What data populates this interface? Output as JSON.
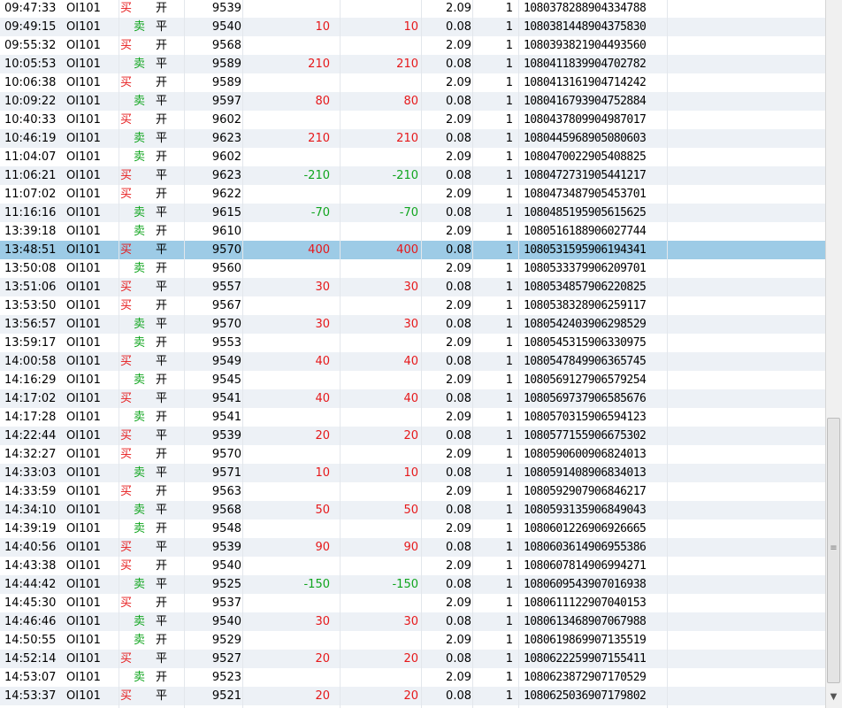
{
  "trades": [
    {
      "time": "09:47:33",
      "code": "OI101",
      "dir": "买",
      "oc": "开",
      "price": "9539",
      "pnl": "",
      "pnl2": "",
      "fee": "2.09",
      "qty": "1",
      "id": "1080378288904334788"
    },
    {
      "time": "09:49:15",
      "code": "OI101",
      "dir": "卖",
      "oc": "平",
      "price": "9540",
      "pnl": "10",
      "pnl2": "10",
      "fee": "0.08",
      "qty": "1",
      "id": "1080381448904375830"
    },
    {
      "time": "09:55:32",
      "code": "OI101",
      "dir": "买",
      "oc": "开",
      "price": "9568",
      "pnl": "",
      "pnl2": "",
      "fee": "2.09",
      "qty": "1",
      "id": "1080393821904493560"
    },
    {
      "time": "10:05:53",
      "code": "OI101",
      "dir": "卖",
      "oc": "平",
      "price": "9589",
      "pnl": "210",
      "pnl2": "210",
      "fee": "0.08",
      "qty": "1",
      "id": "1080411839904702782"
    },
    {
      "time": "10:06:38",
      "code": "OI101",
      "dir": "买",
      "oc": "开",
      "price": "9589",
      "pnl": "",
      "pnl2": "",
      "fee": "2.09",
      "qty": "1",
      "id": "1080413161904714242"
    },
    {
      "time": "10:09:22",
      "code": "OI101",
      "dir": "卖",
      "oc": "平",
      "price": "9597",
      "pnl": "80",
      "pnl2": "80",
      "fee": "0.08",
      "qty": "1",
      "id": "1080416793904752884"
    },
    {
      "time": "10:40:33",
      "code": "OI101",
      "dir": "买",
      "oc": "开",
      "price": "9602",
      "pnl": "",
      "pnl2": "",
      "fee": "2.09",
      "qty": "1",
      "id": "1080437809904987017"
    },
    {
      "time": "10:46:19",
      "code": "OI101",
      "dir": "卖",
      "oc": "平",
      "price": "9623",
      "pnl": "210",
      "pnl2": "210",
      "fee": "0.08",
      "qty": "1",
      "id": "1080445968905080603"
    },
    {
      "time": "11:04:07",
      "code": "OI101",
      "dir": "卖",
      "oc": "开",
      "price": "9602",
      "pnl": "",
      "pnl2": "",
      "fee": "2.09",
      "qty": "1",
      "id": "1080470022905408825"
    },
    {
      "time": "11:06:21",
      "code": "OI101",
      "dir": "买",
      "oc": "平",
      "price": "9623",
      "pnl": "-210",
      "pnl2": "-210",
      "fee": "0.08",
      "qty": "1",
      "id": "1080472731905441217"
    },
    {
      "time": "11:07:02",
      "code": "OI101",
      "dir": "买",
      "oc": "开",
      "price": "9622",
      "pnl": "",
      "pnl2": "",
      "fee": "2.09",
      "qty": "1",
      "id": "1080473487905453701"
    },
    {
      "time": "11:16:16",
      "code": "OI101",
      "dir": "卖",
      "oc": "平",
      "price": "9615",
      "pnl": "-70",
      "pnl2": "-70",
      "fee": "0.08",
      "qty": "1",
      "id": "1080485195905615625"
    },
    {
      "time": "13:39:18",
      "code": "OI101",
      "dir": "卖",
      "oc": "开",
      "price": "9610",
      "pnl": "",
      "pnl2": "",
      "fee": "2.09",
      "qty": "1",
      "id": "1080516188906027744"
    },
    {
      "time": "13:48:51",
      "code": "OI101",
      "dir": "买",
      "oc": "平",
      "price": "9570",
      "pnl": "400",
      "pnl2": "400",
      "fee": "0.08",
      "qty": "1",
      "id": "1080531595906194341",
      "selected": true
    },
    {
      "time": "13:50:08",
      "code": "OI101",
      "dir": "卖",
      "oc": "开",
      "price": "9560",
      "pnl": "",
      "pnl2": "",
      "fee": "2.09",
      "qty": "1",
      "id": "1080533379906209701"
    },
    {
      "time": "13:51:06",
      "code": "OI101",
      "dir": "买",
      "oc": "平",
      "price": "9557",
      "pnl": "30",
      "pnl2": "30",
      "fee": "0.08",
      "qty": "1",
      "id": "1080534857906220825"
    },
    {
      "time": "13:53:50",
      "code": "OI101",
      "dir": "买",
      "oc": "开",
      "price": "9567",
      "pnl": "",
      "pnl2": "",
      "fee": "2.09",
      "qty": "1",
      "id": "1080538328906259117"
    },
    {
      "time": "13:56:57",
      "code": "OI101",
      "dir": "卖",
      "oc": "平",
      "price": "9570",
      "pnl": "30",
      "pnl2": "30",
      "fee": "0.08",
      "qty": "1",
      "id": "1080542403906298529"
    },
    {
      "time": "13:59:17",
      "code": "OI101",
      "dir": "卖",
      "oc": "开",
      "price": "9553",
      "pnl": "",
      "pnl2": "",
      "fee": "2.09",
      "qty": "1",
      "id": "1080545315906330975"
    },
    {
      "time": "14:00:58",
      "code": "OI101",
      "dir": "买",
      "oc": "平",
      "price": "9549",
      "pnl": "40",
      "pnl2": "40",
      "fee": "0.08",
      "qty": "1",
      "id": "1080547849906365745"
    },
    {
      "time": "14:16:29",
      "code": "OI101",
      "dir": "卖",
      "oc": "开",
      "price": "9545",
      "pnl": "",
      "pnl2": "",
      "fee": "2.09",
      "qty": "1",
      "id": "1080569127906579254"
    },
    {
      "time": "14:17:02",
      "code": "OI101",
      "dir": "买",
      "oc": "平",
      "price": "9541",
      "pnl": "40",
      "pnl2": "40",
      "fee": "0.08",
      "qty": "1",
      "id": "1080569737906585676"
    },
    {
      "time": "14:17:28",
      "code": "OI101",
      "dir": "卖",
      "oc": "开",
      "price": "9541",
      "pnl": "",
      "pnl2": "",
      "fee": "2.09",
      "qty": "1",
      "id": "1080570315906594123"
    },
    {
      "time": "14:22:44",
      "code": "OI101",
      "dir": "买",
      "oc": "平",
      "price": "9539",
      "pnl": "20",
      "pnl2": "20",
      "fee": "0.08",
      "qty": "1",
      "id": "1080577155906675302"
    },
    {
      "time": "14:32:27",
      "code": "OI101",
      "dir": "买",
      "oc": "开",
      "price": "9570",
      "pnl": "",
      "pnl2": "",
      "fee": "2.09",
      "qty": "1",
      "id": "1080590600906824013"
    },
    {
      "time": "14:33:03",
      "code": "OI101",
      "dir": "卖",
      "oc": "平",
      "price": "9571",
      "pnl": "10",
      "pnl2": "10",
      "fee": "0.08",
      "qty": "1",
      "id": "1080591408906834013"
    },
    {
      "time": "14:33:59",
      "code": "OI101",
      "dir": "买",
      "oc": "开",
      "price": "9563",
      "pnl": "",
      "pnl2": "",
      "fee": "2.09",
      "qty": "1",
      "id": "1080592907906846217"
    },
    {
      "time": "14:34:10",
      "code": "OI101",
      "dir": "卖",
      "oc": "平",
      "price": "9568",
      "pnl": "50",
      "pnl2": "50",
      "fee": "0.08",
      "qty": "1",
      "id": "1080593135906849043"
    },
    {
      "time": "14:39:19",
      "code": "OI101",
      "dir": "卖",
      "oc": "开",
      "price": "9548",
      "pnl": "",
      "pnl2": "",
      "fee": "2.09",
      "qty": "1",
      "id": "1080601226906926665"
    },
    {
      "time": "14:40:56",
      "code": "OI101",
      "dir": "买",
      "oc": "平",
      "price": "9539",
      "pnl": "90",
      "pnl2": "90",
      "fee": "0.08",
      "qty": "1",
      "id": "1080603614906955386"
    },
    {
      "time": "14:43:38",
      "code": "OI101",
      "dir": "买",
      "oc": "开",
      "price": "9540",
      "pnl": "",
      "pnl2": "",
      "fee": "2.09",
      "qty": "1",
      "id": "1080607814906994271"
    },
    {
      "time": "14:44:42",
      "code": "OI101",
      "dir": "卖",
      "oc": "平",
      "price": "9525",
      "pnl": "-150",
      "pnl2": "-150",
      "fee": "0.08",
      "qty": "1",
      "id": "1080609543907016938"
    },
    {
      "time": "14:45:30",
      "code": "OI101",
      "dir": "买",
      "oc": "开",
      "price": "9537",
      "pnl": "",
      "pnl2": "",
      "fee": "2.09",
      "qty": "1",
      "id": "1080611122907040153"
    },
    {
      "time": "14:46:46",
      "code": "OI101",
      "dir": "卖",
      "oc": "平",
      "price": "9540",
      "pnl": "30",
      "pnl2": "30",
      "fee": "0.08",
      "qty": "1",
      "id": "1080613468907067988"
    },
    {
      "time": "14:50:55",
      "code": "OI101",
      "dir": "卖",
      "oc": "开",
      "price": "9529",
      "pnl": "",
      "pnl2": "",
      "fee": "2.09",
      "qty": "1",
      "id": "1080619869907135519"
    },
    {
      "time": "14:52:14",
      "code": "OI101",
      "dir": "买",
      "oc": "平",
      "price": "9527",
      "pnl": "20",
      "pnl2": "20",
      "fee": "0.08",
      "qty": "1",
      "id": "1080622259907155411"
    },
    {
      "time": "14:53:07",
      "code": "OI101",
      "dir": "卖",
      "oc": "开",
      "price": "9523",
      "pnl": "",
      "pnl2": "",
      "fee": "2.09",
      "qty": "1",
      "id": "1080623872907170529"
    },
    {
      "time": "14:53:37",
      "code": "OI101",
      "dir": "买",
      "oc": "平",
      "price": "9521",
      "pnl": "20",
      "pnl2": "20",
      "fee": "0.08",
      "qty": "1",
      "id": "1080625036907179802"
    }
  ],
  "colors": {
    "buy": "#e6181a",
    "sell": "#10a51e",
    "selected_row": "#9dcbe6",
    "alt_row": "#edf1f6"
  },
  "scrollbar": {
    "grip_icon": "grip-lines-icon",
    "arrow_icon": "chevron-down-icon"
  }
}
